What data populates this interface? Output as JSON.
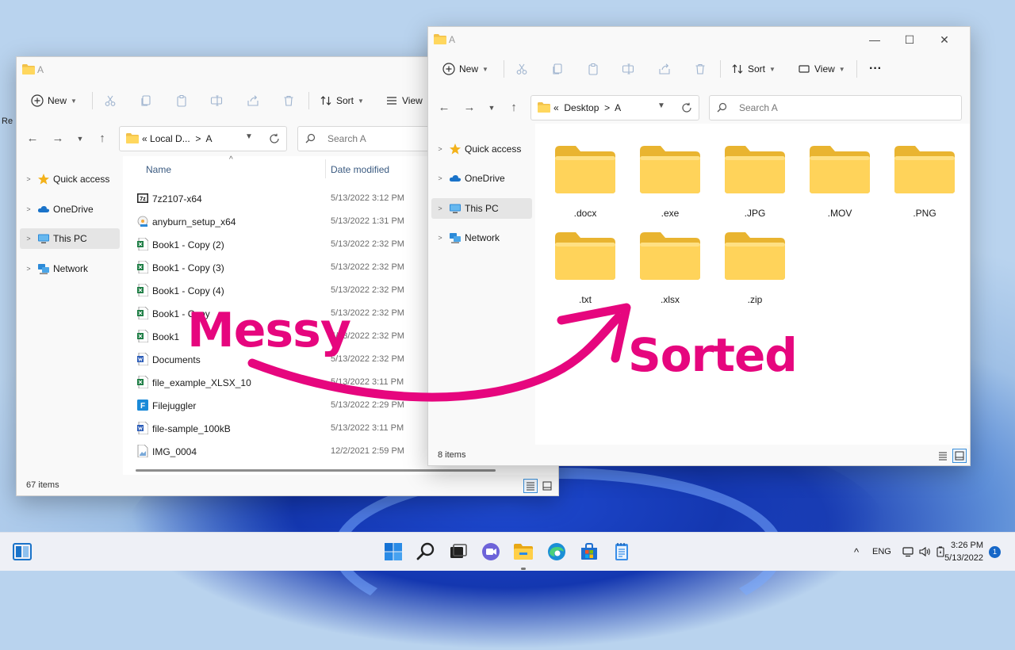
{
  "desktop": {
    "fragment_text": "Re"
  },
  "left_window": {
    "title": "A",
    "toolbar": {
      "new": "New",
      "sort": "Sort",
      "view": "View"
    },
    "address": {
      "prefix": "«",
      "parent": "Local D...",
      "sep": ">",
      "current": "A"
    },
    "search_placeholder": "Search A",
    "nav": [
      {
        "label": "Quick access",
        "icon": "star-icon"
      },
      {
        "label": "OneDrive",
        "icon": "cloud-icon"
      },
      {
        "label": "This PC",
        "icon": "monitor-icon",
        "selected": true
      },
      {
        "label": "Network",
        "icon": "network-icon"
      }
    ],
    "columns": {
      "name": "Name",
      "date": "Date modified"
    },
    "files": [
      {
        "name": "7z2107-x64",
        "date": "5/13/2022 3:12 PM",
        "icon": "7zip-installer-icon"
      },
      {
        "name": "anyburn_setup_x64",
        "date": "5/13/2022 1:31 PM",
        "icon": "installer-icon"
      },
      {
        "name": "Book1 - Copy (2)",
        "date": "5/13/2022 2:32 PM",
        "icon": "excel-file-icon"
      },
      {
        "name": "Book1 - Copy (3)",
        "date": "5/13/2022 2:32 PM",
        "icon": "excel-file-icon"
      },
      {
        "name": "Book1 - Copy (4)",
        "date": "5/13/2022 2:32 PM",
        "icon": "excel-file-icon"
      },
      {
        "name": "Book1 - Copy",
        "date": "5/13/2022 2:32 PM",
        "icon": "excel-file-icon"
      },
      {
        "name": "Book1",
        "date": "5/13/2022 2:32 PM",
        "icon": "excel-file-icon"
      },
      {
        "name": "Documents",
        "date": "5/13/2022 2:32 PM",
        "icon": "word-file-icon"
      },
      {
        "name": "file_example_XLSX_10",
        "date": "5/13/2022 3:11 PM",
        "icon": "excel-file-icon"
      },
      {
        "name": "Filejuggler",
        "date": "5/13/2022 2:29 PM",
        "icon": "filejuggler-app-icon"
      },
      {
        "name": "file-sample_100kB",
        "date": "5/13/2022 3:11 PM",
        "icon": "word-file-icon"
      },
      {
        "name": "IMG_0004",
        "date": "12/2/2021 2:59 PM",
        "icon": "image-file-icon"
      }
    ],
    "status": "67 items"
  },
  "right_window": {
    "title": "A",
    "toolbar": {
      "new": "New",
      "sort": "Sort",
      "view": "View",
      "more": "···"
    },
    "address": {
      "prefix": "«",
      "parent": "Desktop",
      "sep": ">",
      "current": "A"
    },
    "search_placeholder": "Search A",
    "nav": [
      {
        "label": "Quick access",
        "icon": "star-icon"
      },
      {
        "label": "OneDrive",
        "icon": "cloud-icon"
      },
      {
        "label": "This PC",
        "icon": "monitor-icon",
        "selected": true
      },
      {
        "label": "Network",
        "icon": "network-icon"
      }
    ],
    "folders": [
      ".docx",
      ".exe",
      ".JPG",
      ".MOV",
      ".PNG",
      ".txt",
      ".xlsx",
      ".zip"
    ],
    "status": "8 items"
  },
  "overlay": {
    "left_label": "Messy",
    "right_label": "Sorted",
    "color": "#e6067e"
  },
  "taskbar": {
    "language": "ENG",
    "time": "3:26 PM",
    "date": "5/13/2022",
    "notifications": "1"
  }
}
